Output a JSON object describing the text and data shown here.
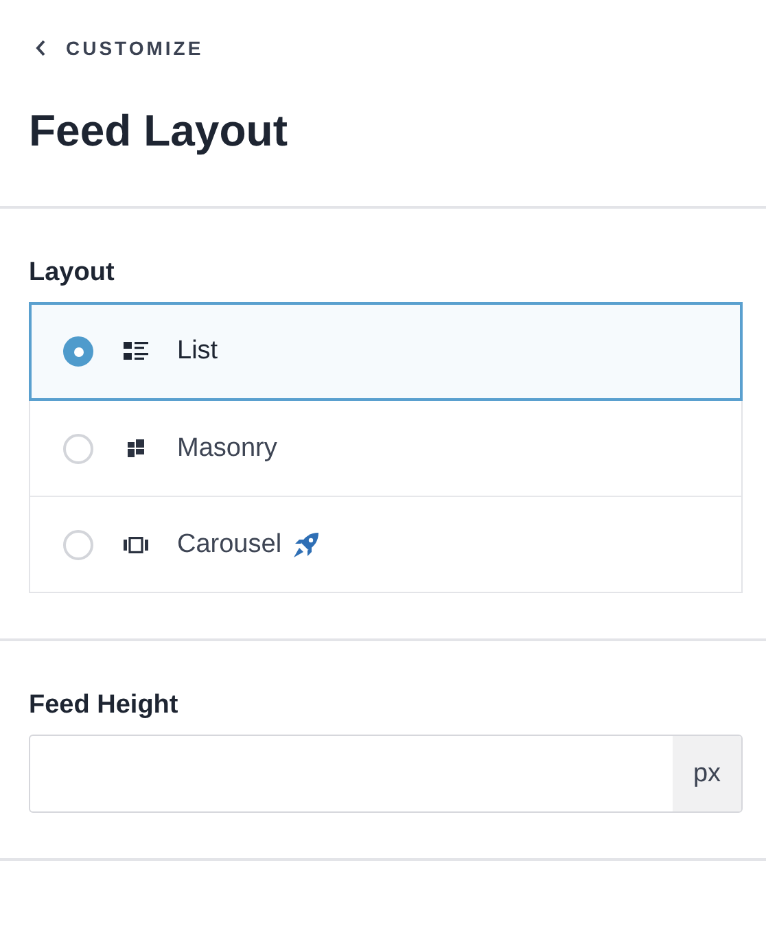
{
  "back_link": {
    "label": "CUSTOMIZE"
  },
  "title": "Feed Layout",
  "layout": {
    "label": "Layout",
    "options": [
      {
        "label": "List",
        "kind": "list",
        "selected": true,
        "pro": false
      },
      {
        "label": "Masonry",
        "kind": "masonry",
        "selected": false,
        "pro": false
      },
      {
        "label": "Carousel",
        "kind": "carousel",
        "selected": false,
        "pro": true
      }
    ]
  },
  "feed_height": {
    "label": "Feed Height",
    "unit": "px"
  }
}
